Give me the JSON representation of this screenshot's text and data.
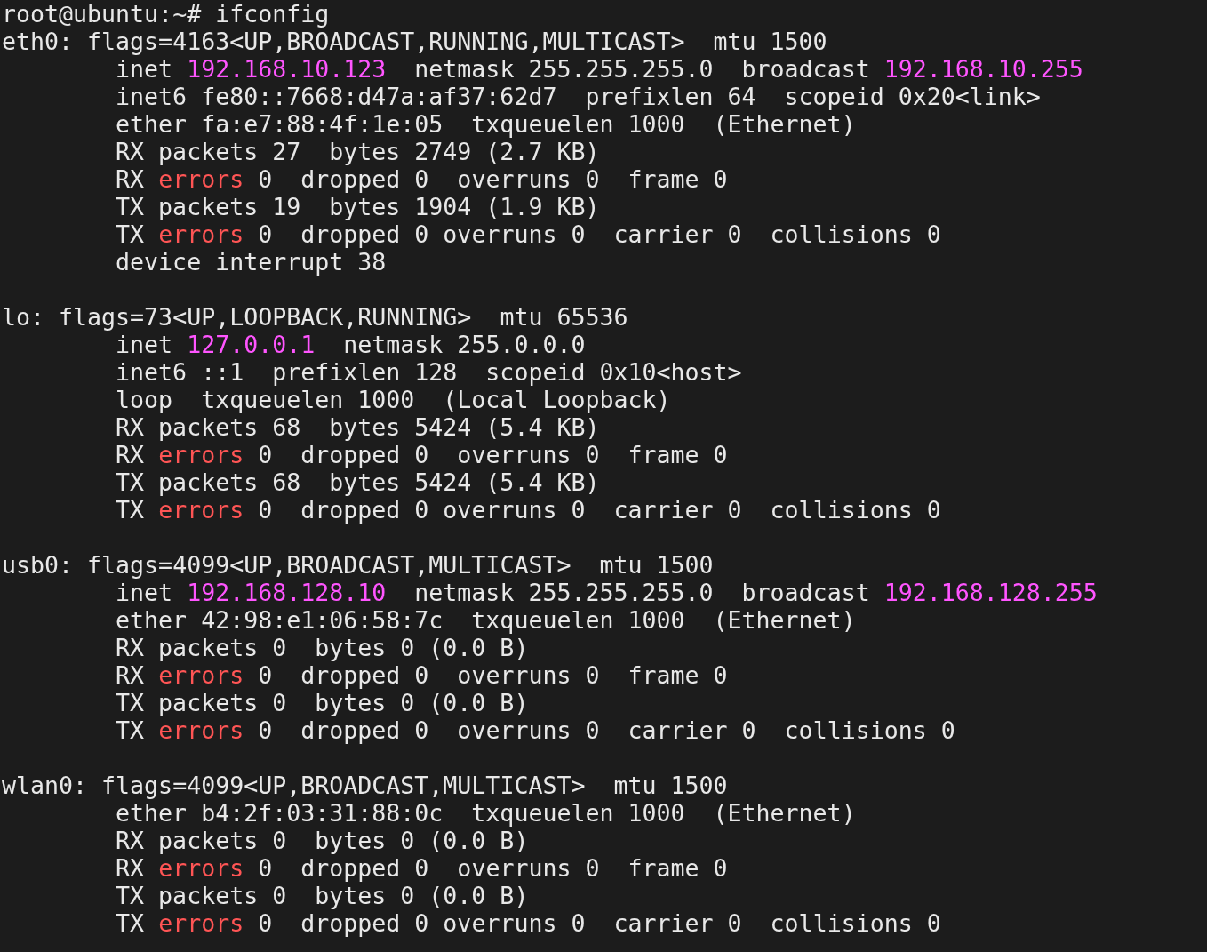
{
  "prompt": "root@ubuntu:~# ifconfig",
  "interfaces": [
    {
      "lines": [
        [
          {
            "kind": "plain",
            "text": "eth0: flags=4163<UP,BROADCAST,RUNNING,MULTICAST>  mtu 1500"
          }
        ],
        [
          {
            "kind": "plain",
            "text": "inet "
          },
          {
            "kind": "address",
            "text": "192.168.10.123"
          },
          {
            "kind": "plain",
            "text": "  netmask 255.255.255.0  broadcast "
          },
          {
            "kind": "address",
            "text": "192.168.10.255"
          }
        ],
        [
          {
            "kind": "plain",
            "text": "inet6 fe80::7668:d47a:af37:62d7  prefixlen 64  scopeid 0x20<link>"
          }
        ],
        [
          {
            "kind": "plain",
            "text": "ether fa:e7:88:4f:1e:05  txqueuelen 1000  (Ethernet)"
          }
        ],
        [
          {
            "kind": "plain",
            "text": "RX packets 27  bytes 2749 (2.7 KB)"
          }
        ],
        [
          {
            "kind": "plain",
            "text": "RX "
          },
          {
            "kind": "error",
            "text": "errors"
          },
          {
            "kind": "plain",
            "text": " 0  dropped 0  overruns 0  frame 0"
          }
        ],
        [
          {
            "kind": "plain",
            "text": "TX packets 19  bytes 1904 (1.9 KB)"
          }
        ],
        [
          {
            "kind": "plain",
            "text": "TX "
          },
          {
            "kind": "error",
            "text": "errors"
          },
          {
            "kind": "plain",
            "text": " 0  dropped 0 overruns 0  carrier 0  collisions 0"
          }
        ],
        [
          {
            "kind": "plain",
            "text": "device interrupt 38"
          }
        ]
      ]
    },
    {
      "lines": [
        [
          {
            "kind": "plain",
            "text": "lo: flags=73<UP,LOOPBACK,RUNNING>  mtu 65536"
          }
        ],
        [
          {
            "kind": "plain",
            "text": "inet "
          },
          {
            "kind": "address",
            "text": "127.0.0.1"
          },
          {
            "kind": "plain",
            "text": "  netmask 255.0.0.0"
          }
        ],
        [
          {
            "kind": "plain",
            "text": "inet6 ::1  prefixlen 128  scopeid 0x10<host>"
          }
        ],
        [
          {
            "kind": "plain",
            "text": "loop  txqueuelen 1000  (Local Loopback)"
          }
        ],
        [
          {
            "kind": "plain",
            "text": "RX packets 68  bytes 5424 (5.4 KB)"
          }
        ],
        [
          {
            "kind": "plain",
            "text": "RX "
          },
          {
            "kind": "error",
            "text": "errors"
          },
          {
            "kind": "plain",
            "text": " 0  dropped 0  overruns 0  frame 0"
          }
        ],
        [
          {
            "kind": "plain",
            "text": "TX packets 68  bytes 5424 (5.4 KB)"
          }
        ],
        [
          {
            "kind": "plain",
            "text": "TX "
          },
          {
            "kind": "error",
            "text": "errors"
          },
          {
            "kind": "plain",
            "text": " 0  dropped 0 overruns 0  carrier 0  collisions 0"
          }
        ]
      ]
    },
    {
      "lines": [
        [
          {
            "kind": "plain",
            "text": "usb0: flags=4099<UP,BROADCAST,MULTICAST>  mtu 1500"
          }
        ],
        [
          {
            "kind": "plain",
            "text": "inet "
          },
          {
            "kind": "address",
            "text": "192.168.128.10"
          },
          {
            "kind": "plain",
            "text": "  netmask 255.255.255.0  broadcast "
          },
          {
            "kind": "address",
            "text": "192.168.128.255"
          }
        ],
        [
          {
            "kind": "plain",
            "text": "ether 42:98:e1:06:58:7c  txqueuelen 1000  (Ethernet)"
          }
        ],
        [
          {
            "kind": "plain",
            "text": "RX packets 0  bytes 0 (0.0 B)"
          }
        ],
        [
          {
            "kind": "plain",
            "text": "RX "
          },
          {
            "kind": "error",
            "text": "errors"
          },
          {
            "kind": "plain",
            "text": " 0  dropped 0  overruns 0  frame 0"
          }
        ],
        [
          {
            "kind": "plain",
            "text": "TX packets 0  bytes 0 (0.0 B)"
          }
        ],
        [
          {
            "kind": "plain",
            "text": "TX "
          },
          {
            "kind": "error",
            "text": "errors"
          },
          {
            "kind": "plain",
            "text": " 0  dropped 0  overruns 0  carrier 0  collisions 0"
          }
        ]
      ]
    },
    {
      "lines": [
        [
          {
            "kind": "plain",
            "text": "wlan0: flags=4099<UP,BROADCAST,MULTICAST>  mtu 1500"
          }
        ],
        [
          {
            "kind": "plain",
            "text": "ether b4:2f:03:31:88:0c  txqueuelen 1000  (Ethernet)"
          }
        ],
        [
          {
            "kind": "plain",
            "text": "RX packets 0  bytes 0 (0.0 B)"
          }
        ],
        [
          {
            "kind": "plain",
            "text": "RX "
          },
          {
            "kind": "error",
            "text": "errors"
          },
          {
            "kind": "plain",
            "text": " 0  dropped 0  overruns 0  frame 0"
          }
        ],
        [
          {
            "kind": "plain",
            "text": "TX packets 0  bytes 0 (0.0 B)"
          }
        ],
        [
          {
            "kind": "plain",
            "text": "TX "
          },
          {
            "kind": "error",
            "text": "errors"
          },
          {
            "kind": "plain",
            "text": " 0  dropped 0 overruns 0  carrier 0  collisions 0"
          }
        ]
      ]
    }
  ]
}
